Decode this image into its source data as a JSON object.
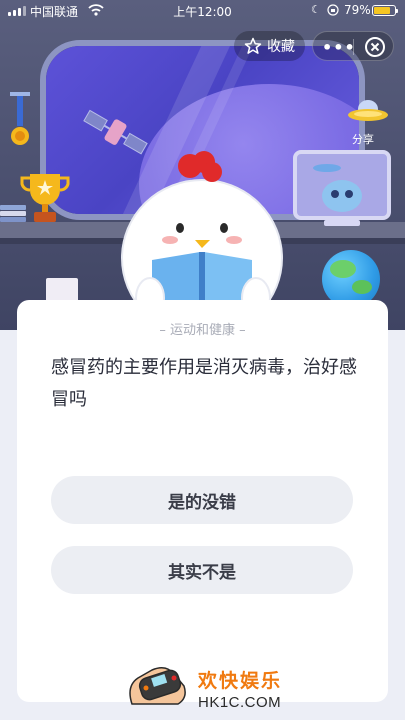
{
  "status_bar": {
    "carrier": "中国联通",
    "time": "上午12:00",
    "battery_percent": "79%",
    "battery_level": 0.79,
    "icons": [
      "signal-icon",
      "wifi-icon",
      "moon-icon",
      "lock-rotation-icon",
      "battery-icon"
    ]
  },
  "header": {
    "favorite_label": "收藏",
    "favorite_icon": "star-outline-icon",
    "more_icon": "more-dots-icon",
    "close_icon": "close-circle-icon",
    "share_label": "分享"
  },
  "card": {
    "category": "运动和健康",
    "question": "感冒药的主要作用是消灭病毒，治好感冒吗",
    "answers": [
      {
        "label": "是的没错"
      },
      {
        "label": "其实不是"
      }
    ]
  },
  "watermark": {
    "title": "欢快娱乐",
    "url": "HK1C.COM"
  },
  "colors": {
    "scene_background": "#4a4f6e",
    "window_glass": "#5d52d8",
    "card_background": "#ffffff",
    "answer_background": "#eceef3",
    "battery_fill": "#f5c623",
    "watermark_orange": "#f07a10"
  }
}
